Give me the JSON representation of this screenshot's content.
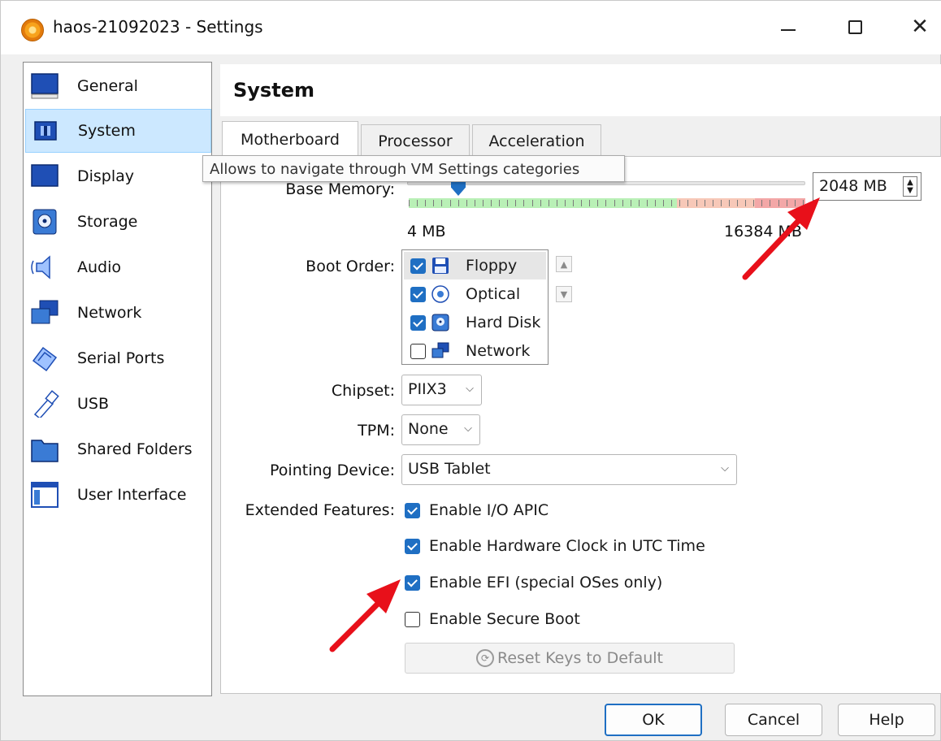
{
  "window": {
    "title": "haos-21092023 - Settings",
    "minimize": "—",
    "maximize": "☐",
    "close": "✕"
  },
  "sidebar": {
    "items": [
      {
        "label": "General",
        "icon": "general-icon"
      },
      {
        "label": "System",
        "icon": "system-icon",
        "selected": true
      },
      {
        "label": "Display",
        "icon": "display-icon"
      },
      {
        "label": "Storage",
        "icon": "storage-icon"
      },
      {
        "label": "Audio",
        "icon": "audio-icon"
      },
      {
        "label": "Network",
        "icon": "network-icon"
      },
      {
        "label": "Serial Ports",
        "icon": "serial-ports-icon"
      },
      {
        "label": "USB",
        "icon": "usb-icon"
      },
      {
        "label": "Shared Folders",
        "icon": "shared-folders-icon"
      },
      {
        "label": "User Interface",
        "icon": "user-interface-icon"
      }
    ]
  },
  "header": {
    "title": "System"
  },
  "tabs": [
    {
      "label": "Motherboard",
      "active": true
    },
    {
      "label": "Processor"
    },
    {
      "label": "Acceleration"
    }
  ],
  "tooltip": "Allows to navigate through VM Settings categories",
  "memory": {
    "label": "Base Memory:",
    "value": "2048 MB",
    "min_label": "4 MB",
    "max_label": "16384 MB",
    "fraction": 0.125
  },
  "boot_order": {
    "label": "Boot Order:",
    "items": [
      {
        "label": "Floppy",
        "checked": true,
        "icon": "floppy-icon"
      },
      {
        "label": "Optical",
        "checked": true,
        "icon": "optical-icon"
      },
      {
        "label": "Hard Disk",
        "checked": true,
        "icon": "hard-disk-icon"
      },
      {
        "label": "Network",
        "checked": false,
        "icon": "network-icon"
      }
    ],
    "up": "▲",
    "down": "▼"
  },
  "chipset": {
    "label": "Chipset:",
    "value": "PIIX3"
  },
  "tpm": {
    "label": "TPM:",
    "value": "None"
  },
  "pointing": {
    "label": "Pointing Device:",
    "value": "USB Tablet"
  },
  "extended": {
    "label": "Extended Features:",
    "options": [
      {
        "label": "Enable I/O APIC",
        "checked": true
      },
      {
        "label": "Enable Hardware Clock in UTC Time",
        "checked": true
      },
      {
        "label": "Enable EFI (special OSes only)",
        "checked": true
      },
      {
        "label": "Enable Secure Boot",
        "checked": false
      }
    ]
  },
  "reset_keys": "Reset Keys to Default",
  "chevron": "⌵",
  "buttons": {
    "ok": "OK",
    "cancel": "Cancel",
    "help": "Help"
  },
  "colors": {
    "accent": "#1f6fc3",
    "selection": "#cce8ff",
    "annotation": "#e8101a"
  }
}
